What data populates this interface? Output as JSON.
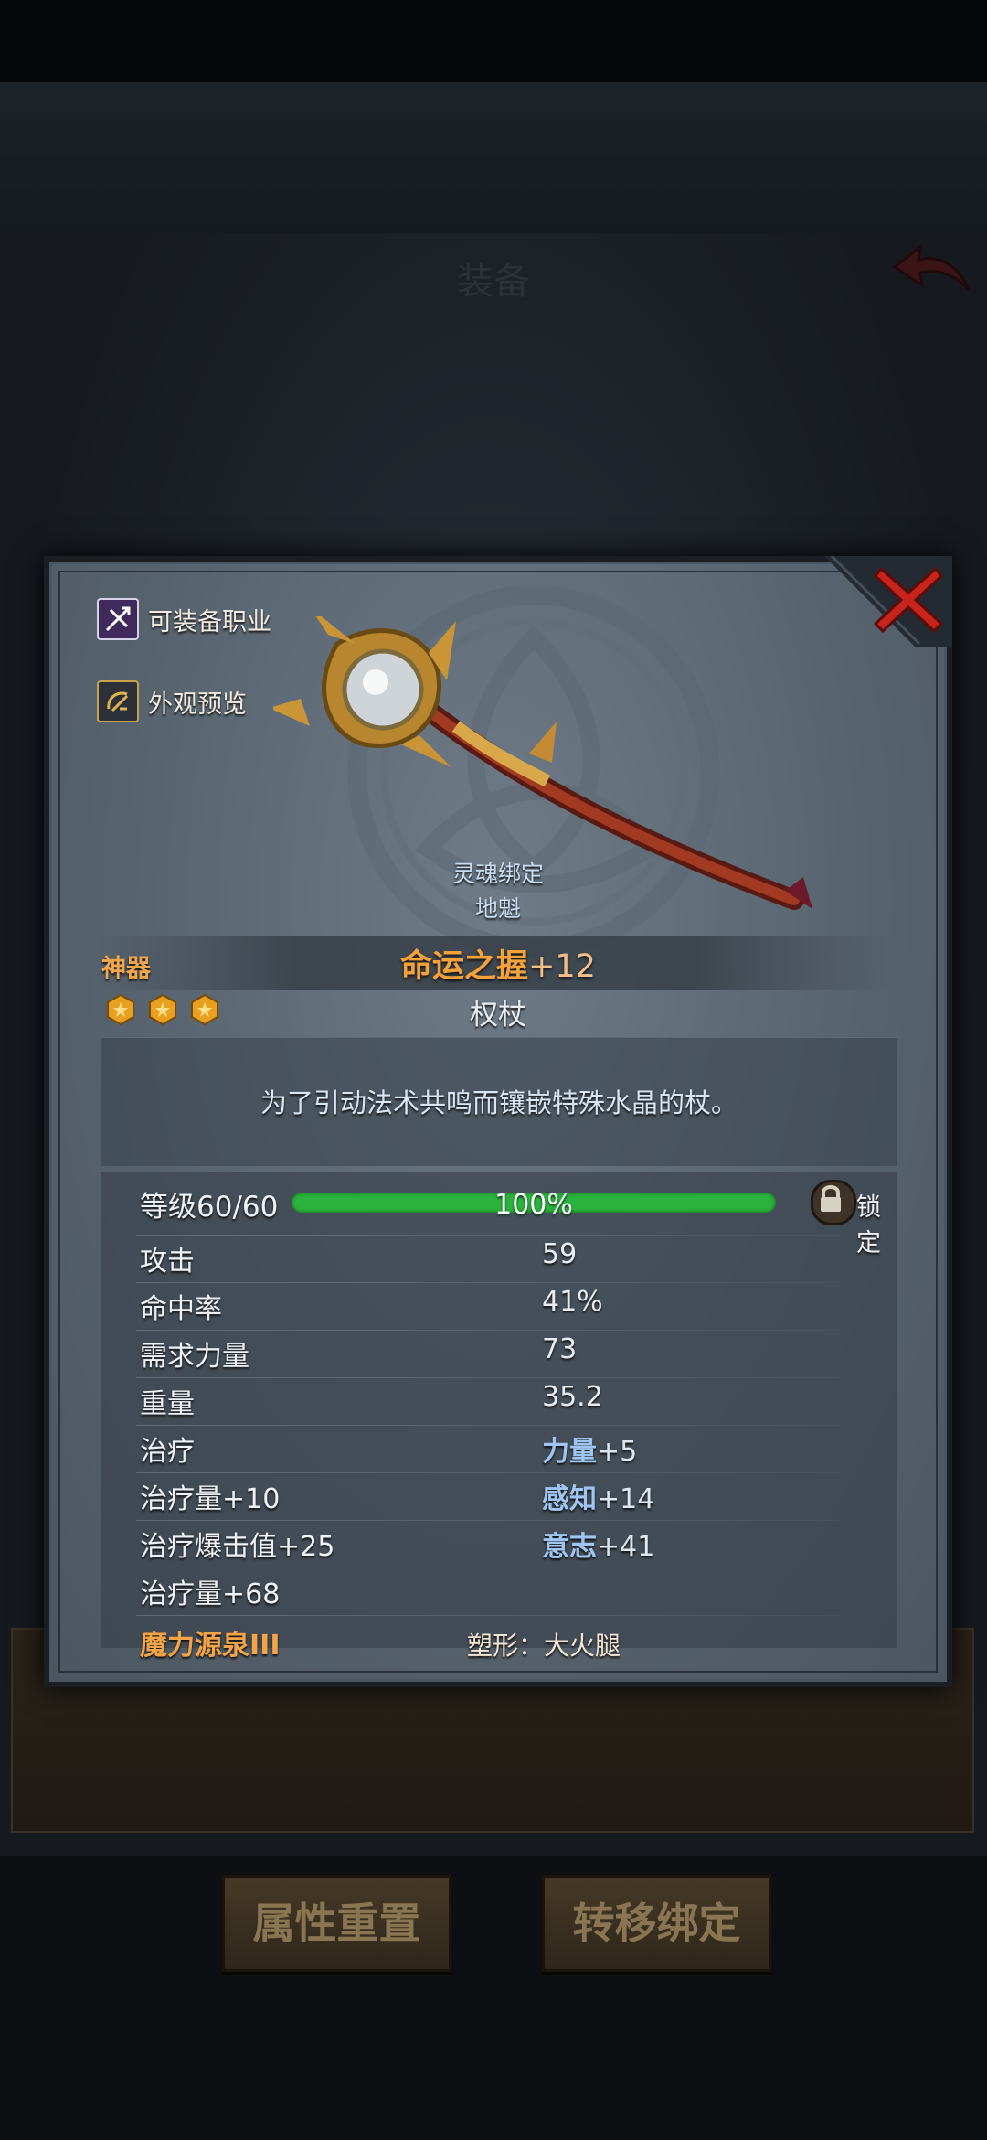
{
  "background": {
    "title": "装备",
    "buttons": {
      "reset_attr": "属性重置",
      "transfer_bind": "转移绑定"
    }
  },
  "modal": {
    "header": {
      "equip_class_label": "可装备职业",
      "appearance_preview_label": "外观预览"
    },
    "soul_bound": {
      "line1": "灵魂绑定",
      "line2": "地魁"
    },
    "item": {
      "rarity": "神器",
      "name": "命运之握",
      "enhance": "+12",
      "type": "权杖",
      "star_count": 3,
      "description": "为了引动法术共鸣而镶嵌特殊水晶的杖。"
    },
    "level": {
      "label": "等级60/60",
      "percent_text": "100%",
      "progress": 1.0,
      "lock_label": "锁定"
    },
    "stats": [
      {
        "key": "攻击",
        "value": "59"
      },
      {
        "key": "命中率",
        "value": "41%"
      },
      {
        "key": "需求力量",
        "value": "73"
      },
      {
        "key": "重量",
        "value": "35.2"
      }
    ],
    "effects_left": [
      {
        "name": "治疗",
        "value": ""
      },
      {
        "name": "治疗量",
        "value": "+10"
      },
      {
        "name": "治疗爆击值",
        "value": "+25"
      },
      {
        "name": "治疗量",
        "value": "+68"
      }
    ],
    "effects_right": [
      {
        "name": "力量",
        "value": "+5"
      },
      {
        "name": "感知",
        "value": "+14"
      },
      {
        "name": "意志",
        "value": "+41"
      }
    ],
    "mana_fount": "魔力源泉III",
    "morph": "塑形：大火腿"
  },
  "colors": {
    "rarity_orange": "#f0a64c",
    "xp_green": "#2cb23e",
    "close_red": "#c8241c",
    "bonus_blue": "#9fc6f2"
  }
}
